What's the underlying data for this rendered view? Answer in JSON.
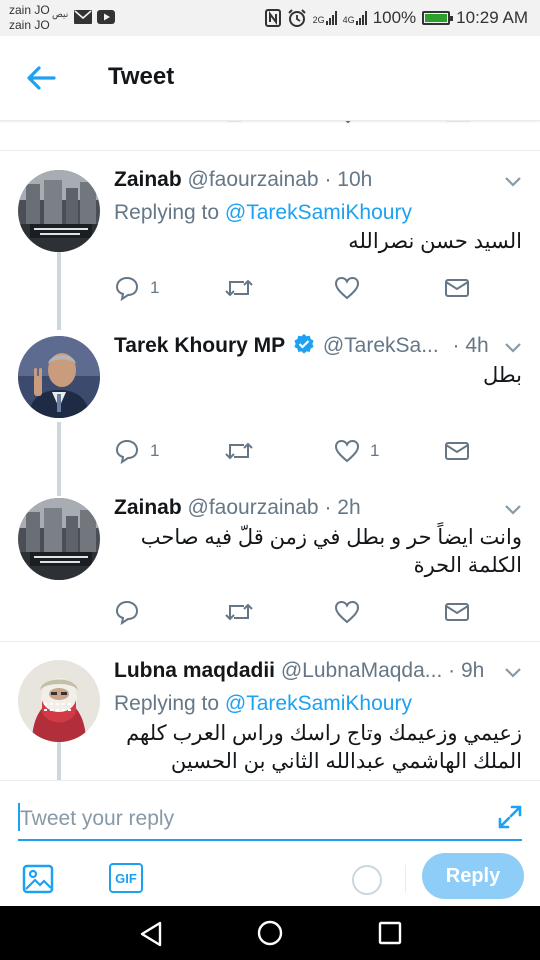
{
  "status_bar": {
    "carrier1": "zain JO",
    "carrier2": "zain JO",
    "extra_text": "نيص",
    "net1": "2G",
    "net2": "4G",
    "battery_text": "100%",
    "battery_level": 1.0,
    "time": "10:29 AM"
  },
  "header": {
    "title": "Tweet"
  },
  "tweets": [
    {
      "name": "Zainab",
      "handle": "@faourzainab",
      "time": "· 10h",
      "replying_prefix": "Replying to",
      "replying_to": "@TarekSamiKhoury",
      "text": "السيد حسن نصرالله",
      "reply_count": "1",
      "retweet_count": "",
      "like_count": ""
    },
    {
      "name": "Tarek Khoury MP",
      "handle": "@TarekSa...",
      "time": "· 4h",
      "text": "بطل",
      "reply_count": "1",
      "retweet_count": "",
      "like_count": "1"
    },
    {
      "name": "Zainab",
      "handle": "@faourzainab",
      "time": "· 2h",
      "text_line1": "وانت ايضاً حر و بطل في زمن قلّ فيه صاحب",
      "text_line2": "الكلمة الحرة",
      "reply_count": "",
      "retweet_count": "",
      "like_count": ""
    },
    {
      "name": "Lubna maqdadii",
      "handle": "@LubnaMaqda...",
      "time": "· 9h",
      "replying_prefix": "Replying to",
      "replying_to": "@TarekSamiKhoury",
      "text_line1": "زعيمي وزعيمك وتاج راسك وراس العرب كلهم",
      "text_line2": "الملك الهاشمي عبدالله الثاني بن الحسين"
    }
  ],
  "composer": {
    "placeholder": "Tweet your reply",
    "gif_label": "GIF",
    "reply_label": "Reply"
  },
  "colors": {
    "accent": "#1da1f2",
    "muted": "#657786",
    "reply_button": "#8ecdf8"
  }
}
